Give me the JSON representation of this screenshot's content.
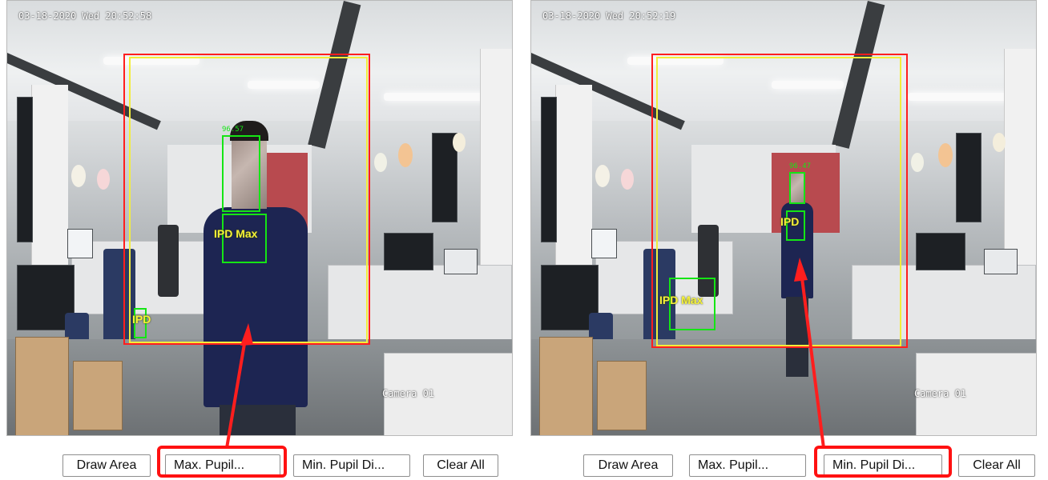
{
  "colors": {
    "area_red": "#ff1e1e",
    "area_yellow": "#f3ee3a",
    "detect_green": "#15e515",
    "label_yellow": "#f6f238",
    "highlight_red": "#ff1111"
  },
  "panels": [
    {
      "timestamp": "03-18-2020 Wed 20:52:58",
      "camera_label": "Camera 01",
      "face_score": "96.57",
      "max_box_label": "IPD Max",
      "min_box_label": "IPD",
      "highlighted_button": "max_pupil",
      "buttons": {
        "draw_area": "Draw Area",
        "max_pupil": "Max. Pupil...",
        "min_pupil": "Min. Pupil Di...",
        "clear_all": "Clear All"
      }
    },
    {
      "timestamp": "03-18-2020 Wed 20:52:19",
      "camera_label": "Camera 01",
      "face_score": "96.47",
      "max_box_label": "IPD Max",
      "min_box_label": "IPD",
      "highlighted_button": "min_pupil",
      "buttons": {
        "draw_area": "Draw Area",
        "max_pupil": "Max. Pupil...",
        "min_pupil": "Min. Pupil Di...",
        "clear_all": "Clear All"
      }
    }
  ]
}
